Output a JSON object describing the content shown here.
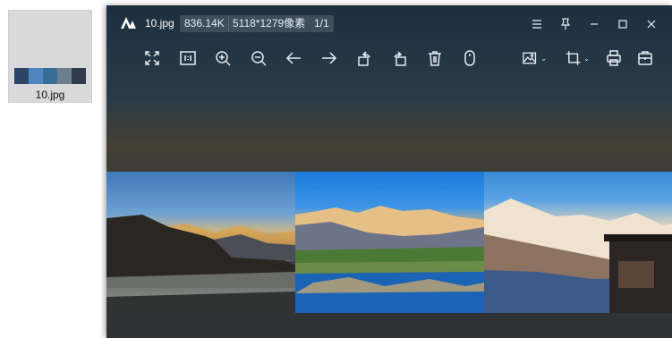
{
  "desktop": {
    "file_name": "10.jpg",
    "thumbnail_colors": [
      "#2c4466",
      "#4f86c0",
      "#3a6c98",
      "#6d7f8f",
      "#2f3b4a"
    ]
  },
  "viewer": {
    "title": "10.jpg",
    "file_size": "836.14K",
    "dimensions": "5118*1279像素",
    "page_indicator": "1/1",
    "window_controls": [
      "menu-icon",
      "pin-icon",
      "minimize-icon",
      "maximize-icon",
      "close-icon"
    ],
    "toolbar": [
      "fullscreen-icon",
      "actual-size-icon",
      "zoom-in-icon",
      "zoom-out-icon",
      "previous-icon",
      "next-icon",
      "rotate-left-icon",
      "rotate-right-icon",
      "delete-icon",
      "mouse-icon",
      "image-tools-icon",
      "crop-icon",
      "print-icon",
      "open-with-icon"
    ],
    "colors": {
      "window_top": "#1d2f40",
      "window_bottom": "#2e3236",
      "chip_text": "#e8eef4"
    }
  }
}
